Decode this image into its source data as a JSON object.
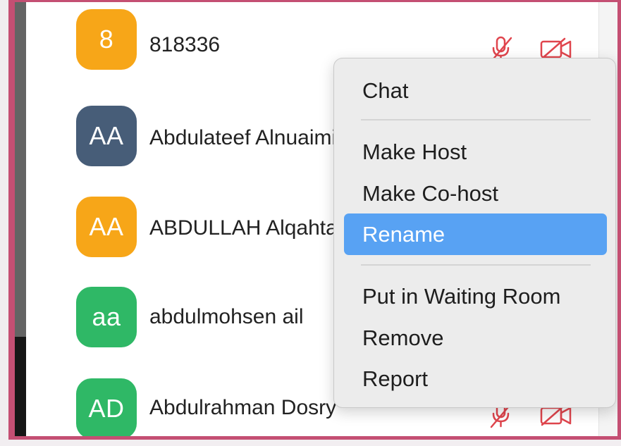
{
  "participants": [
    {
      "initials": "8",
      "name": "818336",
      "color": "#f7a618"
    },
    {
      "initials": "AA",
      "name": "Abdulateef Alnuaimi",
      "color": "#475d78"
    },
    {
      "initials": "AA",
      "name": "ABDULLAH Alqahtani",
      "color": "#f7a618"
    },
    {
      "initials": "aa",
      "name": "abdulmohsen ail",
      "color": "#2fb866"
    },
    {
      "initials": "AD",
      "name": "Abdulrahman Dosry",
      "color": "#2fb866"
    }
  ],
  "context_menu": {
    "items": [
      {
        "label": "Chat"
      },
      {
        "label": "Make Host"
      },
      {
        "label": "Make Co-host"
      },
      {
        "label": "Rename",
        "selected": true
      },
      {
        "label": "Put in Waiting Room"
      },
      {
        "label": "Remove"
      },
      {
        "label": "Report"
      }
    ]
  },
  "icons": {
    "muted_mic": "mic-muted-icon",
    "video_off": "video-off-icon"
  },
  "colors": {
    "muted_icon": "#e0454d",
    "highlight_frame": "#c44f73",
    "menu_selection": "#58a2f3"
  }
}
